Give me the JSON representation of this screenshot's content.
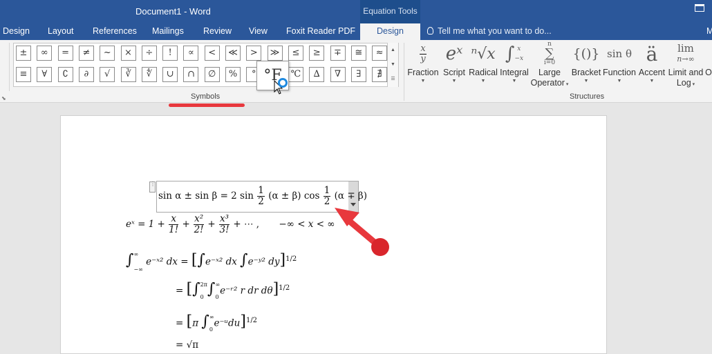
{
  "window": {
    "doc_title": "Document1 - Word",
    "context_label": "Equation Tools"
  },
  "tabs": [
    {
      "label": "Design"
    },
    {
      "label": "Layout"
    },
    {
      "label": "References"
    },
    {
      "label": "Mailings"
    },
    {
      "label": "Review"
    },
    {
      "label": "View"
    },
    {
      "label": "Foxit Reader PDF"
    },
    {
      "label": "Design"
    }
  ],
  "tell_me": "Tell me what you want to do...",
  "user_letter": "M",
  "symbols": {
    "group_label": "Symbols",
    "row1": [
      "±",
      "∞",
      "=",
      "≠",
      "~",
      "×",
      "÷",
      "!",
      "∝",
      "<",
      "≪",
      ">",
      "≫",
      "≤",
      "≥",
      "∓",
      "≅",
      "≈"
    ],
    "row2": [
      "≡",
      "∀",
      "∁",
      "∂",
      "√",
      "∛",
      "∜",
      "∪",
      "∩",
      "∅",
      "%",
      "°",
      "℉",
      "℃",
      "∆",
      "∇",
      "∃",
      "∄"
    ],
    "hover_tooltip": "°F"
  },
  "structures": {
    "group_label": "Structures",
    "items": [
      {
        "label": "Fraction",
        "glyph": "x/y"
      },
      {
        "label": "Script",
        "glyph": "eˣ"
      },
      {
        "label": "Radical",
        "glyph": "ⁿ√x"
      },
      {
        "label": "Integral",
        "glyph": "∫"
      },
      {
        "label": "Large",
        "label2": "Operator",
        "glyph": "∑"
      },
      {
        "label": "Bracket",
        "glyph": "{()}"
      },
      {
        "label": "Function",
        "glyph": "sin θ"
      },
      {
        "label": "Accent",
        "glyph": "ä"
      },
      {
        "label": "Limit and",
        "label2": "Log",
        "glyph": "lim"
      },
      {
        "label": "O",
        "glyph": ""
      }
    ],
    "scripts": {
      "fraction_num": "x",
      "fraction_den": "y",
      "integral_upper": "x",
      "integral_lower": "−x",
      "largeop_upper": "n",
      "largeop_lower": "i=0",
      "limit_sub": "n→∞"
    }
  },
  "equations": {
    "selected": {
      "left": "sin α ± sin β = 2 sin",
      "mid": "(α ± β) cos",
      "right": "(α ∓ β)",
      "frac_num": "1",
      "frac_den": "2"
    },
    "exp": {
      "lhs": "eˣ = 1 +",
      "t1n": "x",
      "t1d": "1!",
      "t2n": "x²",
      "t2d": "2!",
      "t3n": "x³",
      "t3d": "3!",
      "tail": "+ ⋯ ,",
      "range": "−∞ < x < ∞"
    },
    "gauss": {
      "l1_lhs": "∫",
      "l1_lhs_lim_up": "∞",
      "l1_lhs_lim_low": "−∞",
      "l1_lhs_body": "e⁻ˣ² dx =",
      "l1_body": "e⁻ˣ² dx",
      "l1_body2": "e⁻ʸ² dy",
      "power": "1/2",
      "l2_lim_up": "2π",
      "l2_lim_low": "0",
      "l2_lim2_up": "∞",
      "l2_lim2_low": "0",
      "l2_body": "e⁻ʳ² r dr dθ",
      "l3_prefix": "π",
      "l3_body": "e⁻ᵘdu",
      "l4": "= √π"
    }
  }
}
